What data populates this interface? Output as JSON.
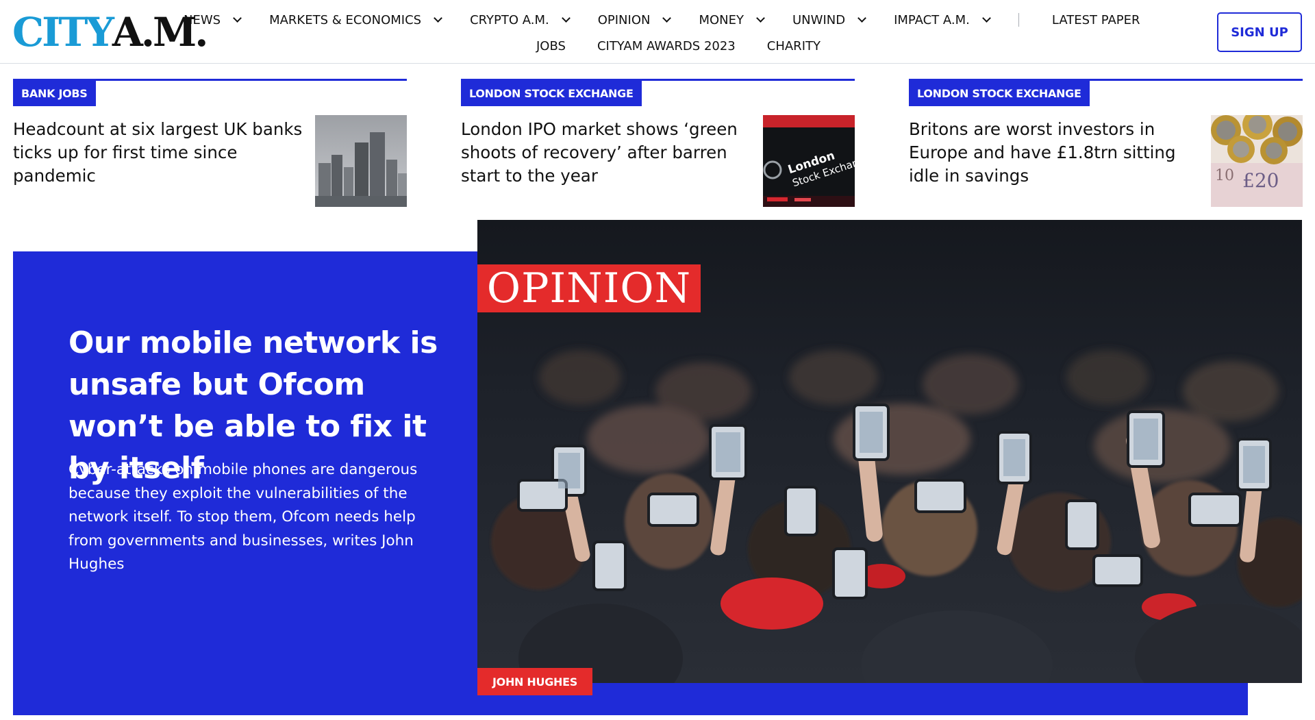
{
  "header": {
    "logo_city": "CITY",
    "logo_am": "A.M.",
    "nav_primary": [
      {
        "label": "NEWS",
        "dropdown": true
      },
      {
        "label": "MARKETS & ECONOMICS",
        "dropdown": true
      },
      {
        "label": "CRYPTO A.M.",
        "dropdown": true
      },
      {
        "label": "OPINION",
        "dropdown": true
      },
      {
        "label": "MONEY",
        "dropdown": true
      },
      {
        "label": "UNWIND",
        "dropdown": true
      },
      {
        "label": "IMPACT A.M.",
        "dropdown": true
      }
    ],
    "nav_latest_paper": "LATEST PAPER",
    "nav_secondary": [
      "JOBS",
      "CITYAM AWARDS 2023",
      "CHARITY"
    ],
    "signup_label": "SIGN UP",
    "accent_color": "#1f2bd8",
    "logo_color": "#1a9bd6"
  },
  "top_stories": [
    {
      "tag": "BANK JOBS",
      "headline": "Headcount at six largest UK banks ticks up for first time since pandemic"
    },
    {
      "tag": "LONDON STOCK EXCHANGE",
      "headline": "London IPO market shows ‘green shoots of recovery’ after barren start to the year",
      "image_text_1": "London",
      "image_text_2": "Stock Exchar"
    },
    {
      "tag": "LONDON STOCK EXCHANGE",
      "headline": "Britons are worst investors in Europe and have £1.8trn sitting idle in savings",
      "image_text_1": "£20",
      "image_text_2": "10"
    }
  ],
  "hero": {
    "badge": "OPINION",
    "title": "Our mobile network is unsafe but Ofcom won’t be able to fix it by itself",
    "subtitle": "Cyber-attacks on mobile phones are dangerous because they exploit the vulnerabilities of the network itself. To stop them, Ofcom needs help from governments and businesses, writes John Hughes",
    "author": "JOHN HUGHES",
    "badge_color": "#e42b2b"
  }
}
